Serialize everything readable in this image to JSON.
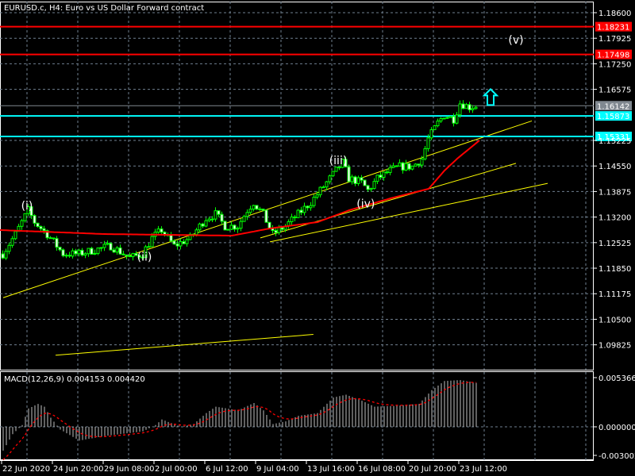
{
  "header": {
    "title": "EURUSD.c, H4:  Euro vs US Dollar Forward contract"
  },
  "colors": {
    "background": "#000000",
    "grid": "#708090",
    "bull": "#00ff00",
    "ma": "#ff0000",
    "trend": "#ffff00",
    "support": "#00ffff",
    "resistance": "#ff0000",
    "bid": "#808890",
    "macd_hist": "#c0c0c0",
    "macd_signal": "#ff0000"
  },
  "price_axis": {
    "ticks": [
      "1.18600",
      "1.17925",
      "1.17250",
      "1.16575",
      "1.15225",
      "1.14550",
      "1.13875",
      "1.13200",
      "1.12525",
      "1.11850",
      "1.11175",
      "1.10500",
      "1.09825"
    ]
  },
  "time_axis": {
    "ticks": [
      "22 Jun 2020",
      "24 Jun 20:00",
      "29 Jun 08:00",
      "2 Jul 00:00",
      "6 Jul 12:00",
      "9 Jul 04:00",
      "13 Jul 16:00",
      "16 Jul 08:00",
      "20 Jul 20:00",
      "23 Jul 12:00"
    ]
  },
  "levels": [
    {
      "label": "1.18231",
      "price": 1.18231,
      "kind": "resistance"
    },
    {
      "label": "1.17498",
      "price": 1.17498,
      "kind": "resistance"
    },
    {
      "label": "1.16142",
      "price": 1.16142,
      "kind": "bid"
    },
    {
      "label": "1.15873",
      "price": 1.15873,
      "kind": "support"
    },
    {
      "label": "1.15331",
      "price": 1.15331,
      "kind": "support"
    }
  ],
  "waves": [
    {
      "label": "(i)",
      "bar": 8.5,
      "price": 1.134
    },
    {
      "label": "(ii)",
      "bar": 45.5,
      "price": 1.1205
    },
    {
      "label": "(iii)",
      "bar": 106.5,
      "price": 1.146
    },
    {
      "label": "(iv)",
      "bar": 115.2,
      "price": 1.1345
    },
    {
      "label": "(v)",
      "bar": 162.5,
      "price": 1.1778
    }
  ],
  "arrow": {
    "icon": "up-arrow-icon",
    "bar": 154.5,
    "price": 1.1637
  },
  "macd": {
    "label": "MACD(12,26,9) 0.004153 0.004420",
    "ticks": [
      "0.005366",
      "0.000000",
      "-0.003002"
    ],
    "max": 0.005366,
    "min": -0.003002
  },
  "chart_data": {
    "type": "candlestick",
    "title": "EURUSD.c, H4",
    "bars": 150,
    "ylim": [
      1.095,
      1.189
    ],
    "close_waypoints": [
      [
        1,
        1.12228
      ],
      [
        5,
        1.12752
      ],
      [
        9,
        1.13381
      ],
      [
        11,
        1.13067
      ],
      [
        15,
        1.12752
      ],
      [
        20,
        1.12228
      ],
      [
        25,
        1.12228
      ],
      [
        30,
        1.12333
      ],
      [
        35,
        1.12438
      ],
      [
        39,
        1.12228
      ],
      [
        41,
        1.12123
      ],
      [
        45,
        1.12228
      ],
      [
        48,
        1.12647
      ],
      [
        51,
        1.12857
      ],
      [
        55,
        1.12438
      ],
      [
        60,
        1.12647
      ],
      [
        65,
        1.13171
      ],
      [
        68,
        1.13276
      ],
      [
        71,
        1.12962
      ],
      [
        75,
        1.12962
      ],
      [
        78,
        1.13381
      ],
      [
        80,
        1.13591
      ],
      [
        83,
        1.13276
      ],
      [
        86,
        1.12752
      ],
      [
        90,
        1.12962
      ],
      [
        94,
        1.13276
      ],
      [
        98,
        1.13591
      ],
      [
        101,
        1.13905
      ],
      [
        105,
        1.14324
      ],
      [
        108,
        1.14639
      ],
      [
        110,
        1.14219
      ],
      [
        114,
        1.14115
      ],
      [
        116,
        1.13905
      ],
      [
        119,
        1.14219
      ],
      [
        123,
        1.14429
      ],
      [
        126,
        1.14534
      ],
      [
        130,
        1.14534
      ],
      [
        133,
        1.14743
      ],
      [
        135,
        1.15267
      ],
      [
        138,
        1.15687
      ],
      [
        140,
        1.15896
      ],
      [
        143,
        1.15791
      ],
      [
        145,
        1.16211
      ],
      [
        148,
        1.16106
      ],
      [
        150,
        1.16142
      ]
    ],
    "ma_waypoints": [
      [
        0,
        1.12857
      ],
      [
        33,
        1.12752
      ],
      [
        73,
        1.1271
      ],
      [
        85,
        1.12899
      ],
      [
        100,
        1.13067
      ],
      [
        110,
        1.13381
      ],
      [
        123,
        1.13695
      ],
      [
        135,
        1.13947
      ],
      [
        140,
        1.14429
      ],
      [
        144,
        1.14743
      ],
      [
        151,
        1.15225
      ]
    ],
    "trendlines": [
      [
        [
          1,
          1.1107
        ],
        [
          167.5,
          1.1574
        ]
      ],
      [
        [
          82,
          1.1265
        ],
        [
          162.5,
          1.1462
        ]
      ],
      [
        [
          85,
          1.12545
        ],
        [
          172.5,
          1.1409
        ]
      ],
      [
        [
          17.5,
          1.0955
        ],
        [
          98.7,
          1.101
        ]
      ]
    ],
    "macd_waypoints": [
      [
        1,
        -0.0026
      ],
      [
        4,
        -0.0008
      ],
      [
        7,
        0.0002
      ],
      [
        9,
        0.002
      ],
      [
        12,
        0.0025
      ],
      [
        14,
        0.0022
      ],
      [
        16,
        0.001
      ],
      [
        19,
        -0.0003
      ],
      [
        25,
        -0.0015
      ],
      [
        33,
        -0.001
      ],
      [
        45,
        -0.0005
      ],
      [
        49,
        0.0002
      ],
      [
        51,
        0.0008
      ],
      [
        57,
        0.0
      ],
      [
        61,
        0.0003
      ],
      [
        65,
        0.0015
      ],
      [
        68,
        0.0022
      ],
      [
        75,
        0.0018
      ],
      [
        80,
        0.0026
      ],
      [
        83,
        0.0018
      ],
      [
        86,
        0.0003
      ],
      [
        90,
        0.0006
      ],
      [
        94,
        0.0012
      ],
      [
        100,
        0.0015
      ],
      [
        105,
        0.0032
      ],
      [
        109,
        0.0035
      ],
      [
        113,
        0.003
      ],
      [
        118,
        0.0022
      ],
      [
        125,
        0.0023
      ],
      [
        132,
        0.0025
      ],
      [
        136,
        0.004
      ],
      [
        140,
        0.005
      ],
      [
        145,
        0.0051
      ],
      [
        150,
        0.0048
      ]
    ]
  }
}
